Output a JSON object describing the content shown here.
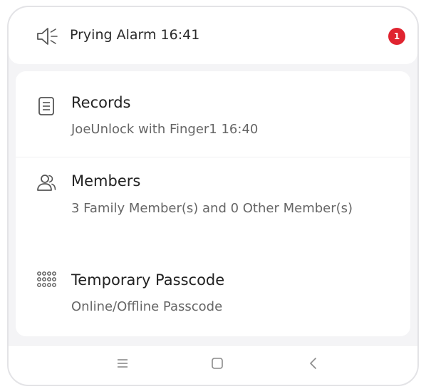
{
  "alarm": {
    "text": "Prying Alarm 16:41",
    "badge_count": "1",
    "icon": "speaker-alarm-icon"
  },
  "menu": {
    "items": [
      {
        "title": "Records",
        "subtitle": "JoeUnlock with Finger1 16:40",
        "icon": "document-list-icon"
      },
      {
        "title": "Members",
        "subtitle": "3 Family Member(s) and 0 Other Member(s)",
        "icon": "people-icon"
      },
      {
        "title": "Temporary Passcode",
        "subtitle": "Online/Offline Passcode",
        "icon": "keypad-icon"
      }
    ]
  },
  "navbar": {
    "buttons": [
      {
        "icon": "menu-lines-icon"
      },
      {
        "icon": "home-square-icon"
      },
      {
        "icon": "back-chevron-icon"
      }
    ]
  },
  "colors": {
    "badge": "#e02430",
    "background": "#f4f4f6",
    "card": "#ffffff",
    "subtitle": "#666666"
  }
}
